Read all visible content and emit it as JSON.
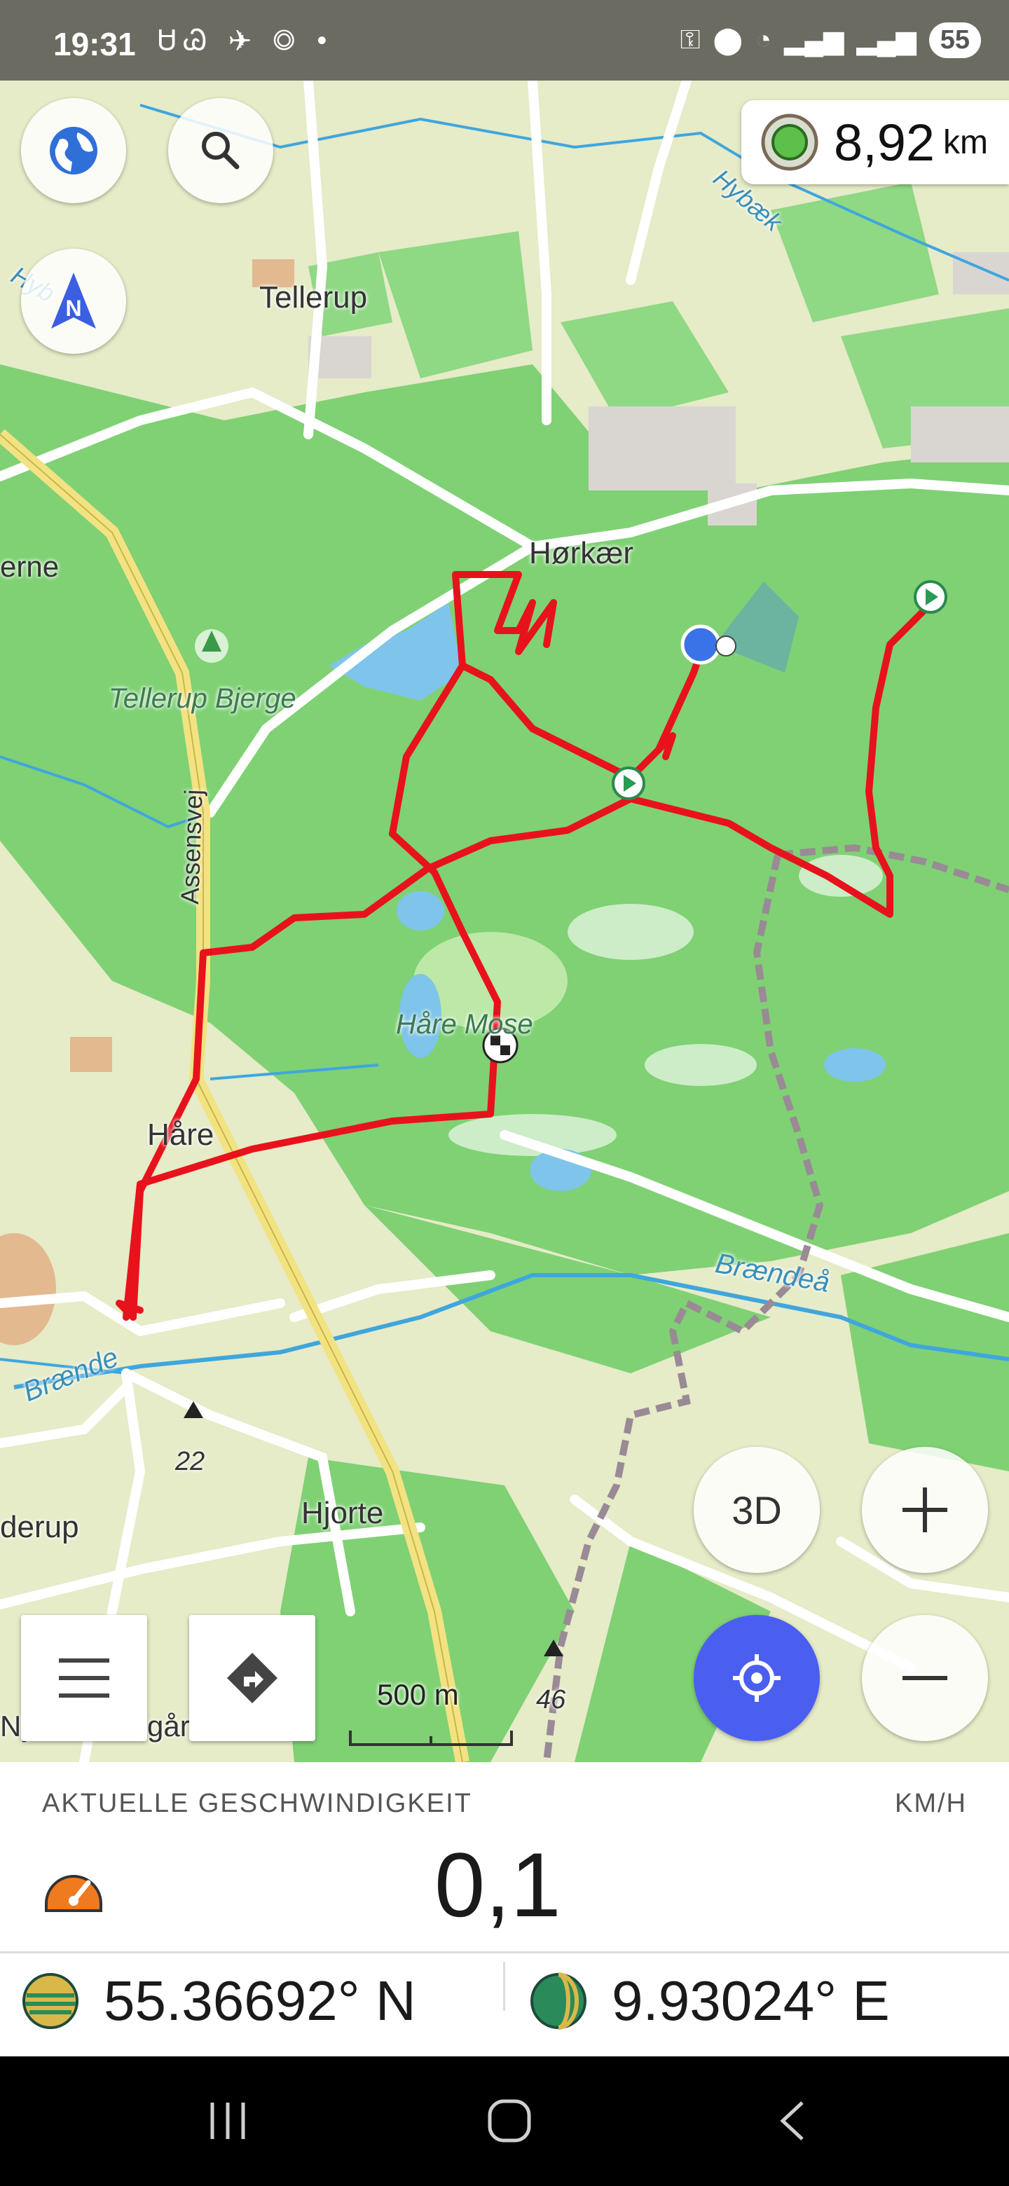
{
  "status_bar": {
    "time": "19:31",
    "notifications": "ᏌᏊ ✈ ◎ •",
    "battery": "55"
  },
  "map": {
    "distance": {
      "value": "8,92",
      "unit": "km"
    },
    "labels": {
      "tellerup": "Tellerup",
      "horkaer": "Hørkær",
      "erne": "erne",
      "tellerup_bjerge": "Tellerup Bjerge",
      "assensvej": "Assensvej",
      "hare_mose": "Håre Mose",
      "hare": "Håre",
      "braendeaa_right": "Brændeå",
      "braendeaa_left": "Brænde",
      "elev_22": "22",
      "hjorte": "Hjorte",
      "derup": "derup",
      "ny": "Ny",
      "gaard": "gåre",
      "elev_46": "46",
      "hybaek": "Hybæk",
      "hybaek_left": "Hyb"
    },
    "scale_label": "500 m",
    "buttons": {
      "three_d": "3D"
    },
    "colors": {
      "route": "#e8121c",
      "forest": "#7fd174",
      "field": "#e6ebc8",
      "water": "#7fc4ea",
      "accent": "#4a5ff0"
    }
  },
  "panel": {
    "title": "AKTUELLE GESCHWINDIGKEIT",
    "unit": "KM/H",
    "speed": "0,1",
    "latitude": "55.36692° N",
    "longitude": "9.93024° E"
  }
}
